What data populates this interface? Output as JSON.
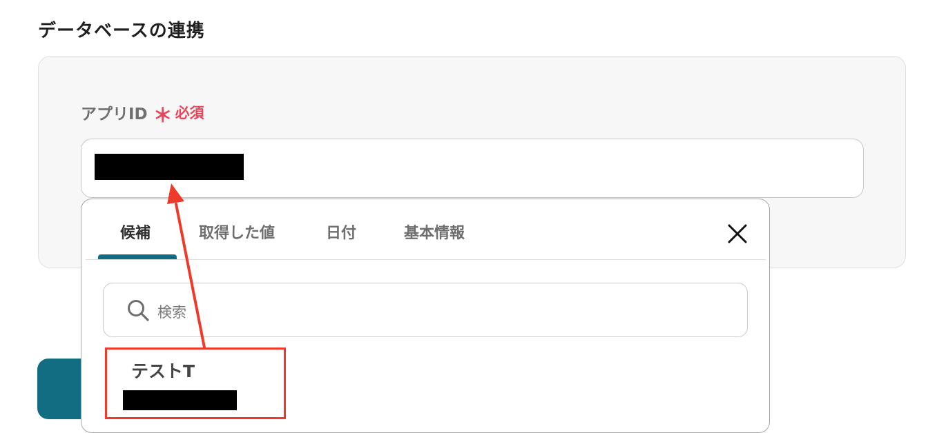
{
  "section": {
    "title": "データベースの連携"
  },
  "field": {
    "label": "アプリID",
    "required_mark": "＊",
    "required_text": "必須"
  },
  "dropdown": {
    "tabs": [
      {
        "label": "候補",
        "active": true
      },
      {
        "label": "取得した値",
        "active": false
      },
      {
        "label": "日付",
        "active": false
      },
      {
        "label": "基本情報",
        "active": false
      }
    ],
    "search": {
      "placeholder": "検索"
    },
    "candidates": [
      {
        "name": "テストT"
      }
    ]
  },
  "colors": {
    "accent": "#126c82",
    "required": "#e8455a",
    "annotation": "#ee3a2b"
  },
  "icons": {
    "close": "close-icon",
    "search": "search-icon"
  }
}
